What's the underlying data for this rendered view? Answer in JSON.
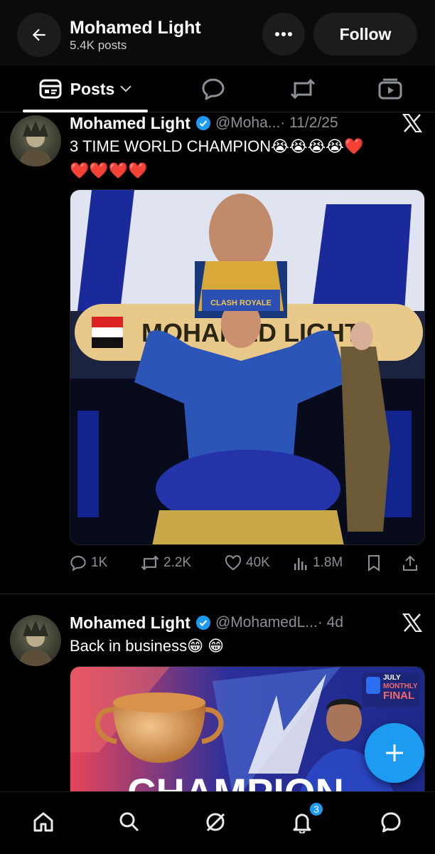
{
  "header": {
    "profile_name": "Mohamed Light",
    "post_count": "5.4K posts",
    "follow_label": "Follow"
  },
  "tabs": {
    "posts_label": "Posts"
  },
  "tweets": [
    {
      "name": "Mohamed Light",
      "handle": "@Moha...",
      "time": "· 11/2/25",
      "text_line1": "3 TIME WORLD CHAMPION😭😭😭😭❤️",
      "text_line2": "❤️❤️❤️❤️",
      "media_text": "MOHAMED LIGHT",
      "crown_text": "CLASH ROYALE",
      "stats": {
        "replies": "1K",
        "reposts": "2.2K",
        "likes": "40K",
        "views": "1.8M"
      }
    },
    {
      "name": "Mohamed Light",
      "handle": "@MohamedL...",
      "time": "· 4d",
      "text_line1": "Back in business😁 😁",
      "media_badge_line1": "JULY",
      "media_badge_line2": "MONTHLY",
      "media_badge_line3": "FINAL",
      "media_title": "CHAMPION"
    }
  ],
  "nav": {
    "notifications_badge": "3"
  },
  "colors": {
    "accent": "#1d9bf0",
    "background": "#000000",
    "secondary_text": "#8b9096"
  }
}
